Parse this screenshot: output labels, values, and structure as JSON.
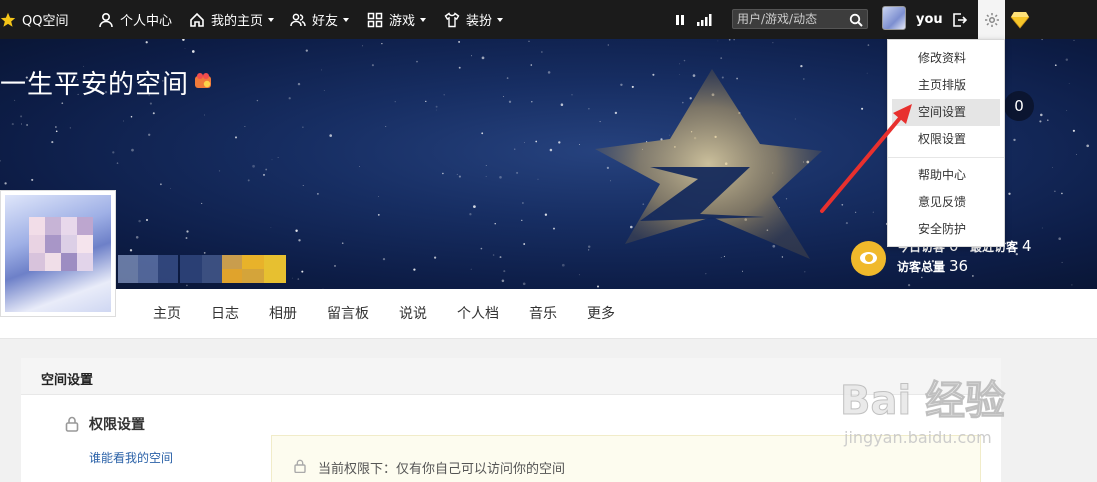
{
  "topbar": {
    "logo_text": "QQ空间",
    "items": [
      {
        "label": "个人中心"
      },
      {
        "label": "我的主页"
      },
      {
        "label": "好友"
      },
      {
        "label": "游戏"
      },
      {
        "label": "装扮"
      }
    ],
    "search_placeholder": "用户/游戏/动态",
    "username": "you"
  },
  "banner": {
    "space_title": "一生平安的空间",
    "counter": "0",
    "visitors": {
      "today_label": "今日访客",
      "today_value": "0",
      "total_label": "访客总量",
      "total_value": "36",
      "recent_label": "最近访客",
      "recent_value": "4"
    }
  },
  "nav": {
    "items": [
      "主页",
      "日志",
      "相册",
      "留言板",
      "说说",
      "个人档",
      "音乐",
      "更多"
    ]
  },
  "dropdown": {
    "items": [
      "修改资料",
      "主页排版",
      "空间设置",
      "权限设置",
      "帮助中心",
      "意见反馈",
      "安全防护"
    ],
    "active": "空间设置"
  },
  "panel": {
    "title": "空间设置",
    "section_title": "权限设置",
    "link": "谁能看我的空间",
    "notice": "当前权限下：仅有你自己可以访问你的空间"
  },
  "watermark": {
    "brand": "Bai 经验",
    "url": "jingyan.baidu.com"
  },
  "colors": {
    "topbar_bg": "#1b1b1b",
    "banner_bg": "#172e63",
    "accent_link": "#2b62a8",
    "arrow": "#e8302e",
    "visitor_icon": "#f0b92b"
  }
}
